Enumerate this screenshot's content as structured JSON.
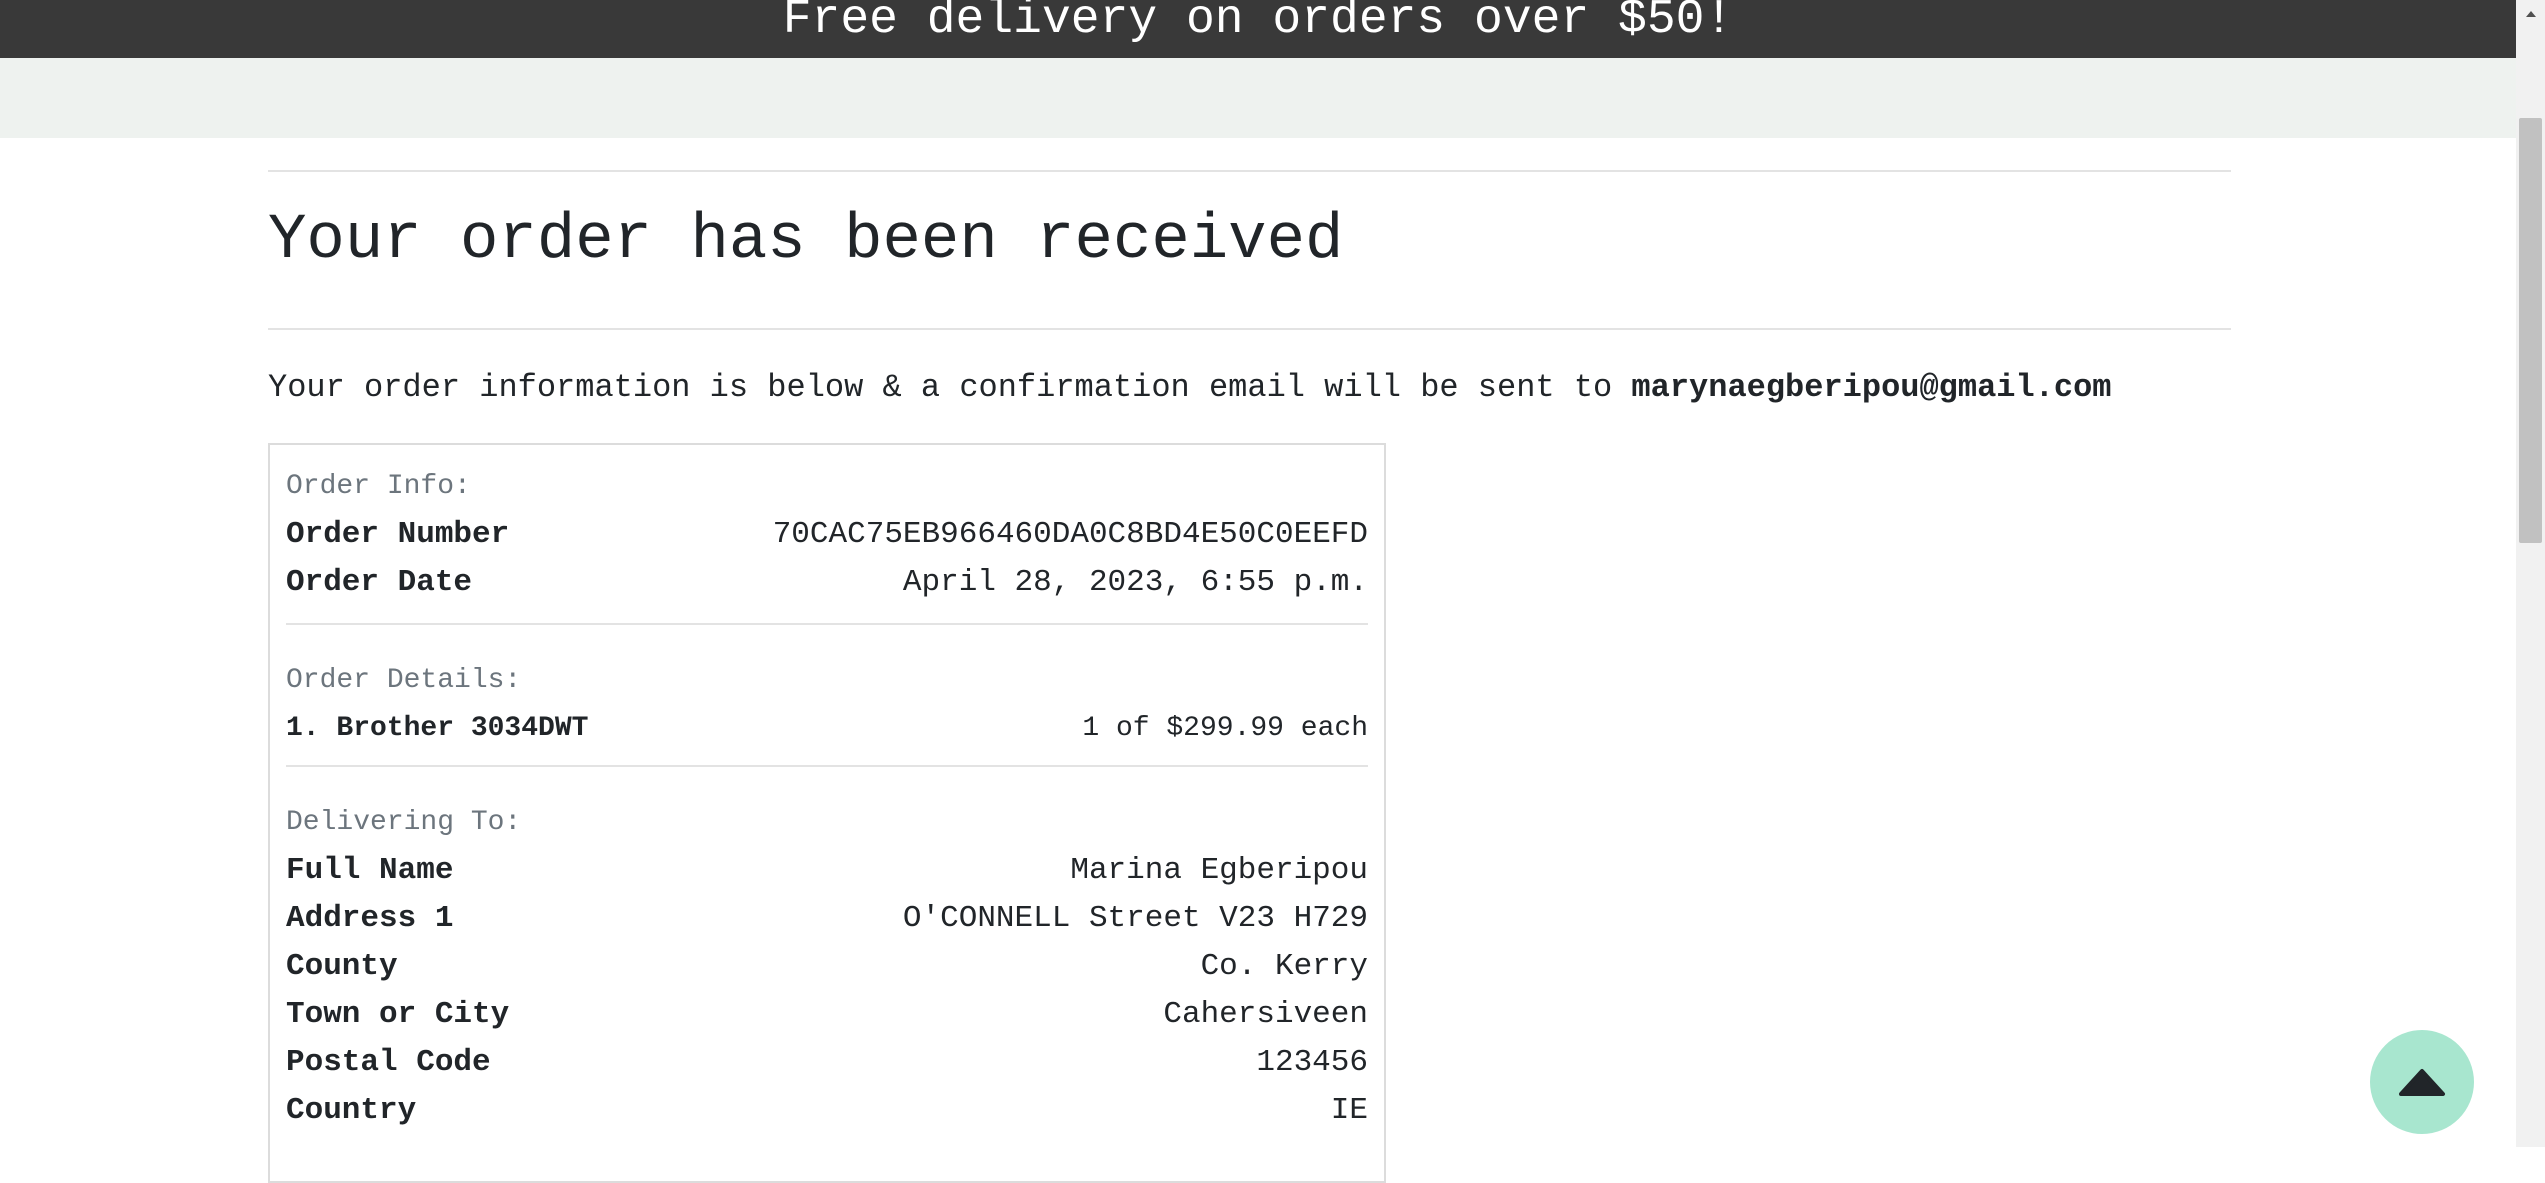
{
  "banner": {
    "text": "Free delivery on orders over $50!"
  },
  "page": {
    "title": "Your order has been received",
    "intro_text": "Your order information is below & a confirmation email will be sent to",
    "email": "marynaegberipou@gmail.com"
  },
  "order_info": {
    "label": "Order Info:",
    "number_label": "Order Number",
    "number_value": "70CAC75EB966460DA0C8BD4E50C0EEFD",
    "date_label": "Order Date",
    "date_value": "April 28, 2023, 6:55 p.m."
  },
  "order_details": {
    "label": "Order Details:",
    "items": [
      {
        "name": "1. Brother 3034DWT",
        "qty_price": "1 of $299.99 each"
      }
    ]
  },
  "delivery": {
    "label": "Delivering To:",
    "rows": [
      {
        "label": "Full Name",
        "value": "Marina Egberipou"
      },
      {
        "label": "Address 1",
        "value": "O'CONNELL Street V23 H729"
      },
      {
        "label": "County",
        "value": "Co. Kerry"
      },
      {
        "label": "Town or City",
        "value": "Cahersiveen"
      },
      {
        "label": "Postal Code",
        "value": "123456"
      },
      {
        "label": "Country",
        "value": "IE"
      }
    ]
  },
  "icons": {
    "back_to_top": "caret-up-icon",
    "scroll_up": "scroll-up-arrow-icon"
  },
  "colors": {
    "banner_bg": "#393939",
    "subbar_bg": "#eef2ef",
    "back_to_top_bg": "#a8e6cf",
    "muted_text": "#6c757d"
  }
}
